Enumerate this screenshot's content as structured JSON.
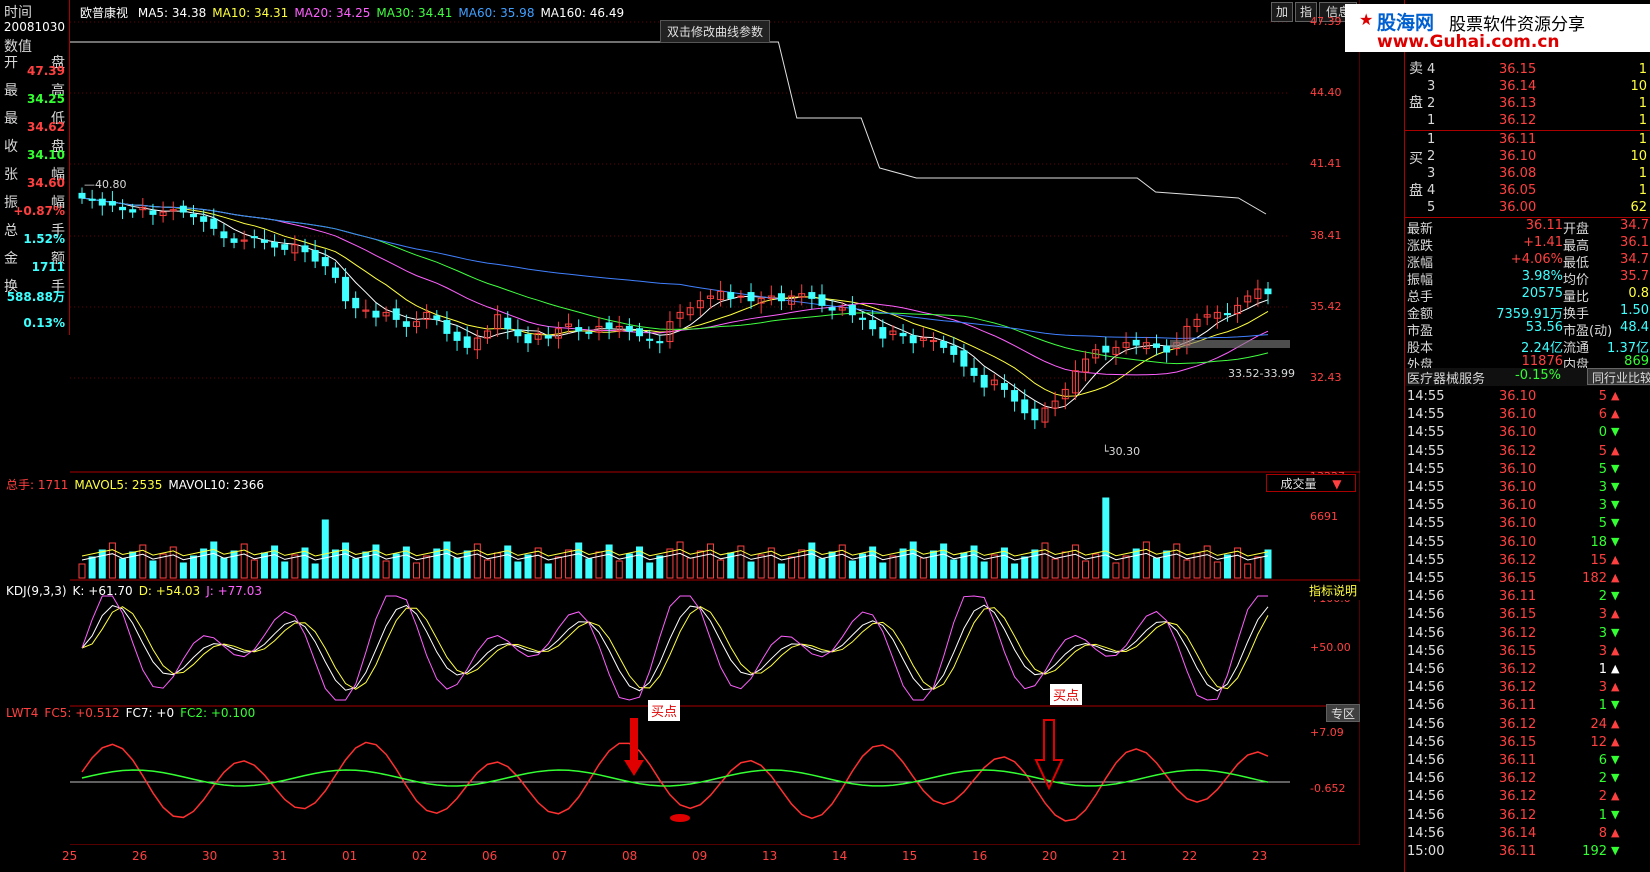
{
  "header": {
    "stock_name": "欧普康视",
    "ma_labels": [
      {
        "text": "MA5: 34.38",
        "color": "#ffffff"
      },
      {
        "text": "MA10: 34.31",
        "color": "#ffff40"
      },
      {
        "text": "MA20: 34.25",
        "color": "#ff60ff"
      },
      {
        "text": "MA30: 34.41",
        "color": "#40ff40"
      },
      {
        "text": "MA60: 35.98",
        "color": "#40a0ff"
      },
      {
        "text": "MA160: 46.49",
        "color": "#ffffff"
      }
    ],
    "buttons": [
      "加",
      "指",
      "信息"
    ],
    "tooltip": "双击修改曲线参数"
  },
  "left_info": {
    "time_label": "时间",
    "date": "20081030",
    "value_label": "数值",
    "items": [
      {
        "l1": "开",
        "l2": "盘",
        "value": "47.39",
        "color": "#ff4040"
      },
      {
        "l1": "最",
        "l2": "高",
        "value": "34.25",
        "color": "#33ff33"
      },
      {
        "l1": "最",
        "l2": "低",
        "value": "34.62",
        "color": "#ff4040"
      },
      {
        "l1": "收",
        "l2": "盘",
        "value": "34.10",
        "color": "#33ff33"
      },
      {
        "l1": "张",
        "l2": "幅",
        "value": "34.60",
        "color": "#ff4040"
      },
      {
        "l1": "振",
        "l2": "幅",
        "value": "+0.87%",
        "color": "#ff4040"
      },
      {
        "l1": "总",
        "l2": "手",
        "value": "1.52%",
        "color": "#40ffff"
      },
      {
        "l1": "金",
        "l2": "额",
        "value": "1711",
        "color": "#40ffff"
      },
      {
        "l1": "换",
        "l2": "手",
        "value": "588.88万",
        "color": "#40ffff"
      },
      {
        "l1": "",
        "l2": "",
        "value": "0.13%",
        "color": "#40ffff"
      }
    ]
  },
  "price_axis": [
    "47.39",
    "44.40",
    "41.41",
    "38.41",
    "35.42",
    "32.43"
  ],
  "price_annotations": {
    "high": "40.80",
    "low": "30.30",
    "range": "33.52-33.99"
  },
  "volume_panel": {
    "title_parts": [
      {
        "text": "总手: 1711",
        "color": "#ff4040"
      },
      {
        "text": "MAVOL5: 2535",
        "color": "#ffff40"
      },
      {
        "text": "MAVOL10: 2366",
        "color": "#ffffff"
      }
    ],
    "dropdown": "成交量",
    "axis": [
      "13227",
      "6691"
    ]
  },
  "kdj_panel": {
    "title_parts": [
      {
        "text": "KDJ(9,3,3)",
        "color": "#ffffff"
      },
      {
        "text": "K: +61.70",
        "color": "#ffffff"
      },
      {
        "text": "D: +54.03",
        "color": "#ffff40"
      },
      {
        "text": "J: +77.03",
        "color": "#ff60ff"
      }
    ],
    "button": "指标说明",
    "axis": [
      "+100.0",
      "+50.00"
    ]
  },
  "lwt_panel": {
    "title_parts": [
      {
        "text": "LWT4",
        "color": "#ff4040"
      },
      {
        "text": "FC5: +0.512",
        "color": "#ff4040"
      },
      {
        "text": "FC7: +0",
        "color": "#ffffff"
      },
      {
        "text": "FC2: +0.100",
        "color": "#33ff33"
      }
    ],
    "button": "专区",
    "axis": [
      "+7.09",
      "-0.652"
    ],
    "buy_labels": [
      "买点",
      "买点"
    ]
  },
  "date_axis": [
    "25",
    "26",
    "30",
    "31",
    "01",
    "02",
    "06",
    "07",
    "08",
    "09",
    "13",
    "14",
    "15",
    "16",
    "20",
    "21",
    "22",
    "23"
  ],
  "right_panel": {
    "watermark_site": "股海网",
    "watermark_slogan": "股票软件资源分享",
    "watermark_url": "www.Guhai.com.cn",
    "sell_label": [
      "卖",
      "盘"
    ],
    "buy_label": [
      "买",
      "盘"
    ],
    "sell_rows": [
      {
        "n": "4",
        "price": "36.15",
        "vol": "1"
      },
      {
        "n": "3",
        "price": "36.14",
        "vol": "10"
      },
      {
        "n": "2",
        "price": "36.13",
        "vol": "1"
      },
      {
        "n": "1",
        "price": "36.12",
        "vol": "1"
      }
    ],
    "buy_rows": [
      {
        "n": "1",
        "price": "36.11",
        "vol": "1"
      },
      {
        "n": "2",
        "price": "36.10",
        "vol": "10"
      },
      {
        "n": "3",
        "price": "36.08",
        "vol": "1"
      },
      {
        "n": "4",
        "price": "36.05",
        "vol": "1"
      },
      {
        "n": "5",
        "price": "36.00",
        "vol": "62"
      }
    ],
    "stats": [
      {
        "l1": "最新",
        "v1": "36.11",
        "c1": "#ff4040",
        "l2": "开盘",
        "v2": "34.7",
        "c2": "#ff4040"
      },
      {
        "l1": "涨跌",
        "v1": "+1.41",
        "c1": "#ff4040",
        "l2": "最高",
        "v2": "36.1",
        "c2": "#ff4040"
      },
      {
        "l1": "涨幅",
        "v1": "+4.06%",
        "c1": "#ff4040",
        "l2": "最低",
        "v2": "34.7",
        "c2": "#ff4040"
      },
      {
        "l1": "振幅",
        "v1": "3.98%",
        "c1": "#40ffff",
        "l2": "均价",
        "v2": "35.7",
        "c2": "#ff4040"
      },
      {
        "l1": "总手",
        "v1": "20575",
        "c1": "#40ffff",
        "l2": "量比",
        "v2": "0.8",
        "c2": "#ffff40"
      },
      {
        "l1": "金额",
        "v1": "7359.91万",
        "c1": "#40ffff",
        "l2": "换手",
        "v2": "1.50",
        "c2": "#40ffff"
      },
      {
        "l1": "市盈",
        "v1": "53.56",
        "c1": "#40ffff",
        "l2": "市盈(动)",
        "v2": "48.4",
        "c2": "#40ffff"
      },
      {
        "l1": "股本",
        "v1": "2.24亿",
        "c1": "#40ffff",
        "l2": "流通",
        "v2": "1.37亿",
        "c2": "#40ffff"
      },
      {
        "l1": "外盘",
        "v1": "11876",
        "c1": "#ff4040",
        "l2": "内盘",
        "v2": "869",
        "c2": "#33ff33"
      }
    ],
    "sector": {
      "name": "医疗器械服务",
      "change": "-0.15%",
      "button": "同行业比较"
    },
    "ticks": [
      {
        "t": "14:55",
        "p": "36.10",
        "v": "5",
        "d": "up"
      },
      {
        "t": "14:55",
        "p": "36.10",
        "v": "6",
        "d": "up"
      },
      {
        "t": "14:55",
        "p": "36.10",
        "v": "0",
        "d": "down"
      },
      {
        "t": "14:55",
        "p": "36.12",
        "v": "5",
        "d": "up"
      },
      {
        "t": "14:55",
        "p": "36.10",
        "v": "5",
        "d": "down"
      },
      {
        "t": "14:55",
        "p": "36.10",
        "v": "3",
        "d": "down"
      },
      {
        "t": "14:55",
        "p": "36.10",
        "v": "3",
        "d": "down"
      },
      {
        "t": "14:55",
        "p": "36.10",
        "v": "5",
        "d": "down"
      },
      {
        "t": "14:55",
        "p": "36.10",
        "v": "18",
        "d": "down"
      },
      {
        "t": "14:55",
        "p": "36.12",
        "v": "15",
        "d": "up"
      },
      {
        "t": "14:55",
        "p": "36.15",
        "v": "182",
        "d": "up"
      },
      {
        "t": "14:56",
        "p": "36.11",
        "v": "2",
        "d": "down"
      },
      {
        "t": "14:56",
        "p": "36.15",
        "v": "3",
        "d": "up"
      },
      {
        "t": "14:56",
        "p": "36.12",
        "v": "3",
        "d": "down"
      },
      {
        "t": "14:56",
        "p": "36.15",
        "v": "3",
        "d": "up"
      },
      {
        "t": "14:56",
        "p": "36.12",
        "v": "1",
        "d": "flat"
      },
      {
        "t": "14:56",
        "p": "36.12",
        "v": "3",
        "d": "up"
      },
      {
        "t": "14:56",
        "p": "36.11",
        "v": "1",
        "d": "down"
      },
      {
        "t": "14:56",
        "p": "36.12",
        "v": "24",
        "d": "up"
      },
      {
        "t": "14:56",
        "p": "36.15",
        "v": "12",
        "d": "up"
      },
      {
        "t": "14:56",
        "p": "36.11",
        "v": "6",
        "d": "down"
      },
      {
        "t": "14:56",
        "p": "36.12",
        "v": "2",
        "d": "down"
      },
      {
        "t": "14:56",
        "p": "36.12",
        "v": "2",
        "d": "up"
      },
      {
        "t": "14:56",
        "p": "36.12",
        "v": "1",
        "d": "down"
      },
      {
        "t": "14:56",
        "p": "36.14",
        "v": "8",
        "d": "up"
      },
      {
        "t": "15:00",
        "p": "36.11",
        "v": "192",
        "d": "down"
      }
    ]
  },
  "chart_data": {
    "type": "candlestick",
    "series_count_hint": "daily candles with MA lines",
    "closes": [
      40.2,
      40.1,
      39.9,
      39.9,
      39.7,
      39.6,
      39.8,
      39.5,
      39.6,
      39.7,
      39.6,
      39.4,
      39.2,
      38.9,
      38.5,
      38.3,
      38.4,
      38.5,
      38.3,
      38.1,
      38.0,
      38.2,
      37.9,
      37.5,
      37.3,
      36.8,
      35.8,
      35.5,
      35.4,
      35.1,
      35.3,
      35.0,
      34.7,
      34.9,
      35.3,
      35.0,
      34.4,
      34.1,
      33.8,
      34.2,
      34.5,
      35.2,
      34.6,
      34.3,
      34.0,
      34.4,
      34.2,
      34.6,
      34.8,
      34.5,
      34.4,
      34.7,
      34.6,
      34.7,
      34.5,
      34.3,
      34.1,
      34.0,
      34.9,
      35.3,
      35.5,
      35.8,
      36.0,
      36.2,
      35.9,
      36.0,
      35.8,
      35.9,
      36.0,
      35.8,
      36.0,
      36.1,
      35.9,
      35.6,
      35.4,
      35.5,
      35.2,
      35.0,
      34.6,
      34.2,
      34.5,
      34.3,
      34.0,
      34.2,
      34.1,
      33.8,
      33.5,
      33.0,
      32.6,
      32.1,
      32.4,
      32.0,
      31.5,
      31.0,
      30.7,
      31.2,
      31.5,
      32.0,
      32.8,
      33.3,
      33.7,
      33.6,
      33.8,
      34.0,
      33.9,
      34.0,
      33.8,
      33.6,
      34.0,
      34.7,
      35.0,
      35.2,
      35.3,
      35.2,
      35.6,
      36.0,
      36.3,
      36.1
    ]
  }
}
